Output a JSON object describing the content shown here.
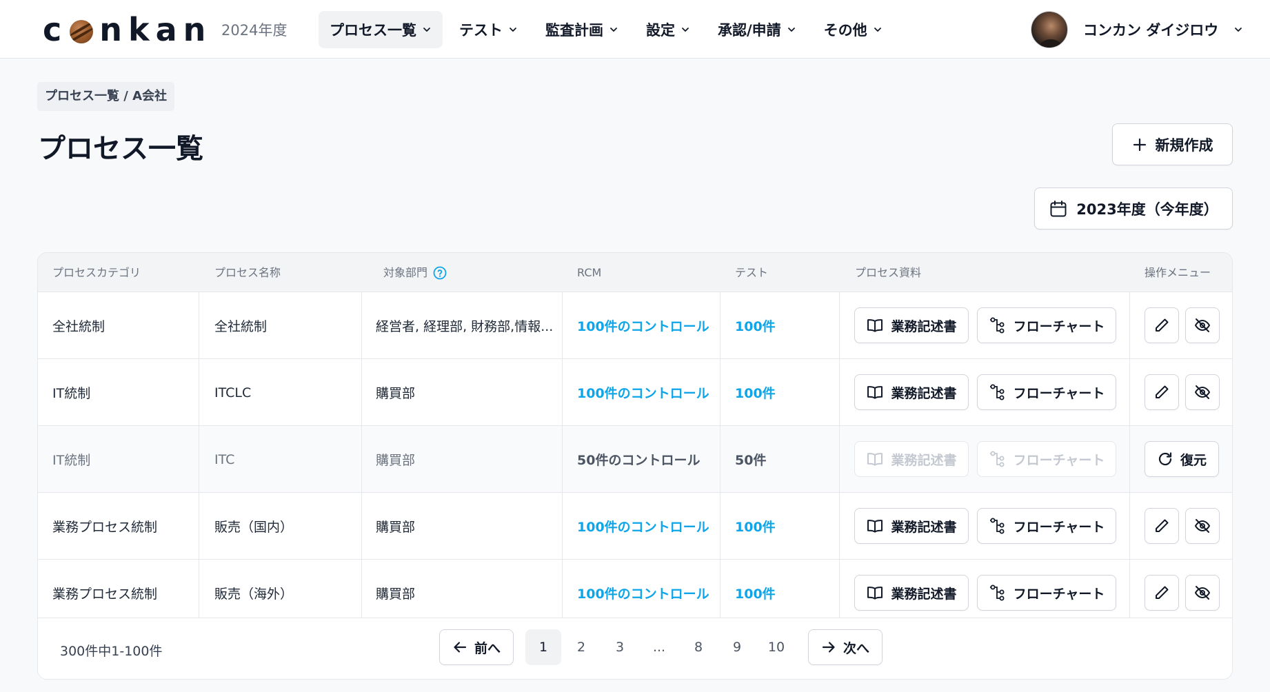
{
  "header": {
    "logo": "c nkan",
    "fiscal_year": "2024年度",
    "nav": [
      {
        "label": "プロセス一覧",
        "active": true
      },
      {
        "label": "テスト",
        "active": false
      },
      {
        "label": "監査計画",
        "active": false
      },
      {
        "label": "設定",
        "active": false
      },
      {
        "label": "承認/申請",
        "active": false
      },
      {
        "label": "その他",
        "active": false
      }
    ],
    "user_name": "コンカン ダイジロウ"
  },
  "page": {
    "breadcrumb": "プロセス一覧 / A会社",
    "title": "プロセス一覧",
    "new_button": "新規作成",
    "year_button": "2023年度（今年度）"
  },
  "table": {
    "columns": {
      "category": "プロセスカテゴリ",
      "name": "プロセス名称",
      "department": "対象部門",
      "rcm": "RCM",
      "test": "テスト",
      "docs": "プロセス資料",
      "ops": "操作メニュー"
    },
    "doc_labels": {
      "narrative": "業務記述書",
      "flowchart": "フローチャート"
    },
    "restore_label": "復元",
    "rows": [
      {
        "category": "全社統制",
        "name": "全社統制",
        "department": "経営者, 経理部, 財務部,情報...",
        "rcm": "100件のコントロール",
        "test": "100件"
      },
      {
        "category": "IT統制",
        "name": "ITCLC",
        "department": "購買部",
        "rcm": "100件のコントロール",
        "test": "100件"
      },
      {
        "category": "IT統制",
        "name": "ITC",
        "department": "購買部",
        "rcm": "50件のコントロール",
        "test": "50件"
      },
      {
        "category": "業務プロセス統制",
        "name": "販売（国内）",
        "department": "購買部",
        "rcm": "100件のコントロール",
        "test": "100件"
      },
      {
        "category": "業務プロセス統制",
        "name": "販売（海外）",
        "department": "購買部",
        "rcm": "100件のコントロール",
        "test": "100件"
      }
    ]
  },
  "pagination": {
    "summary": "300件中1-100件",
    "prev_label": "前へ",
    "next_label": "次へ",
    "pages": [
      "1",
      "2",
      "3",
      "...",
      "8",
      "9",
      "10"
    ],
    "current_page": "1"
  },
  "colors": {
    "accent": "#0ea5e9",
    "text": "#111827"
  }
}
